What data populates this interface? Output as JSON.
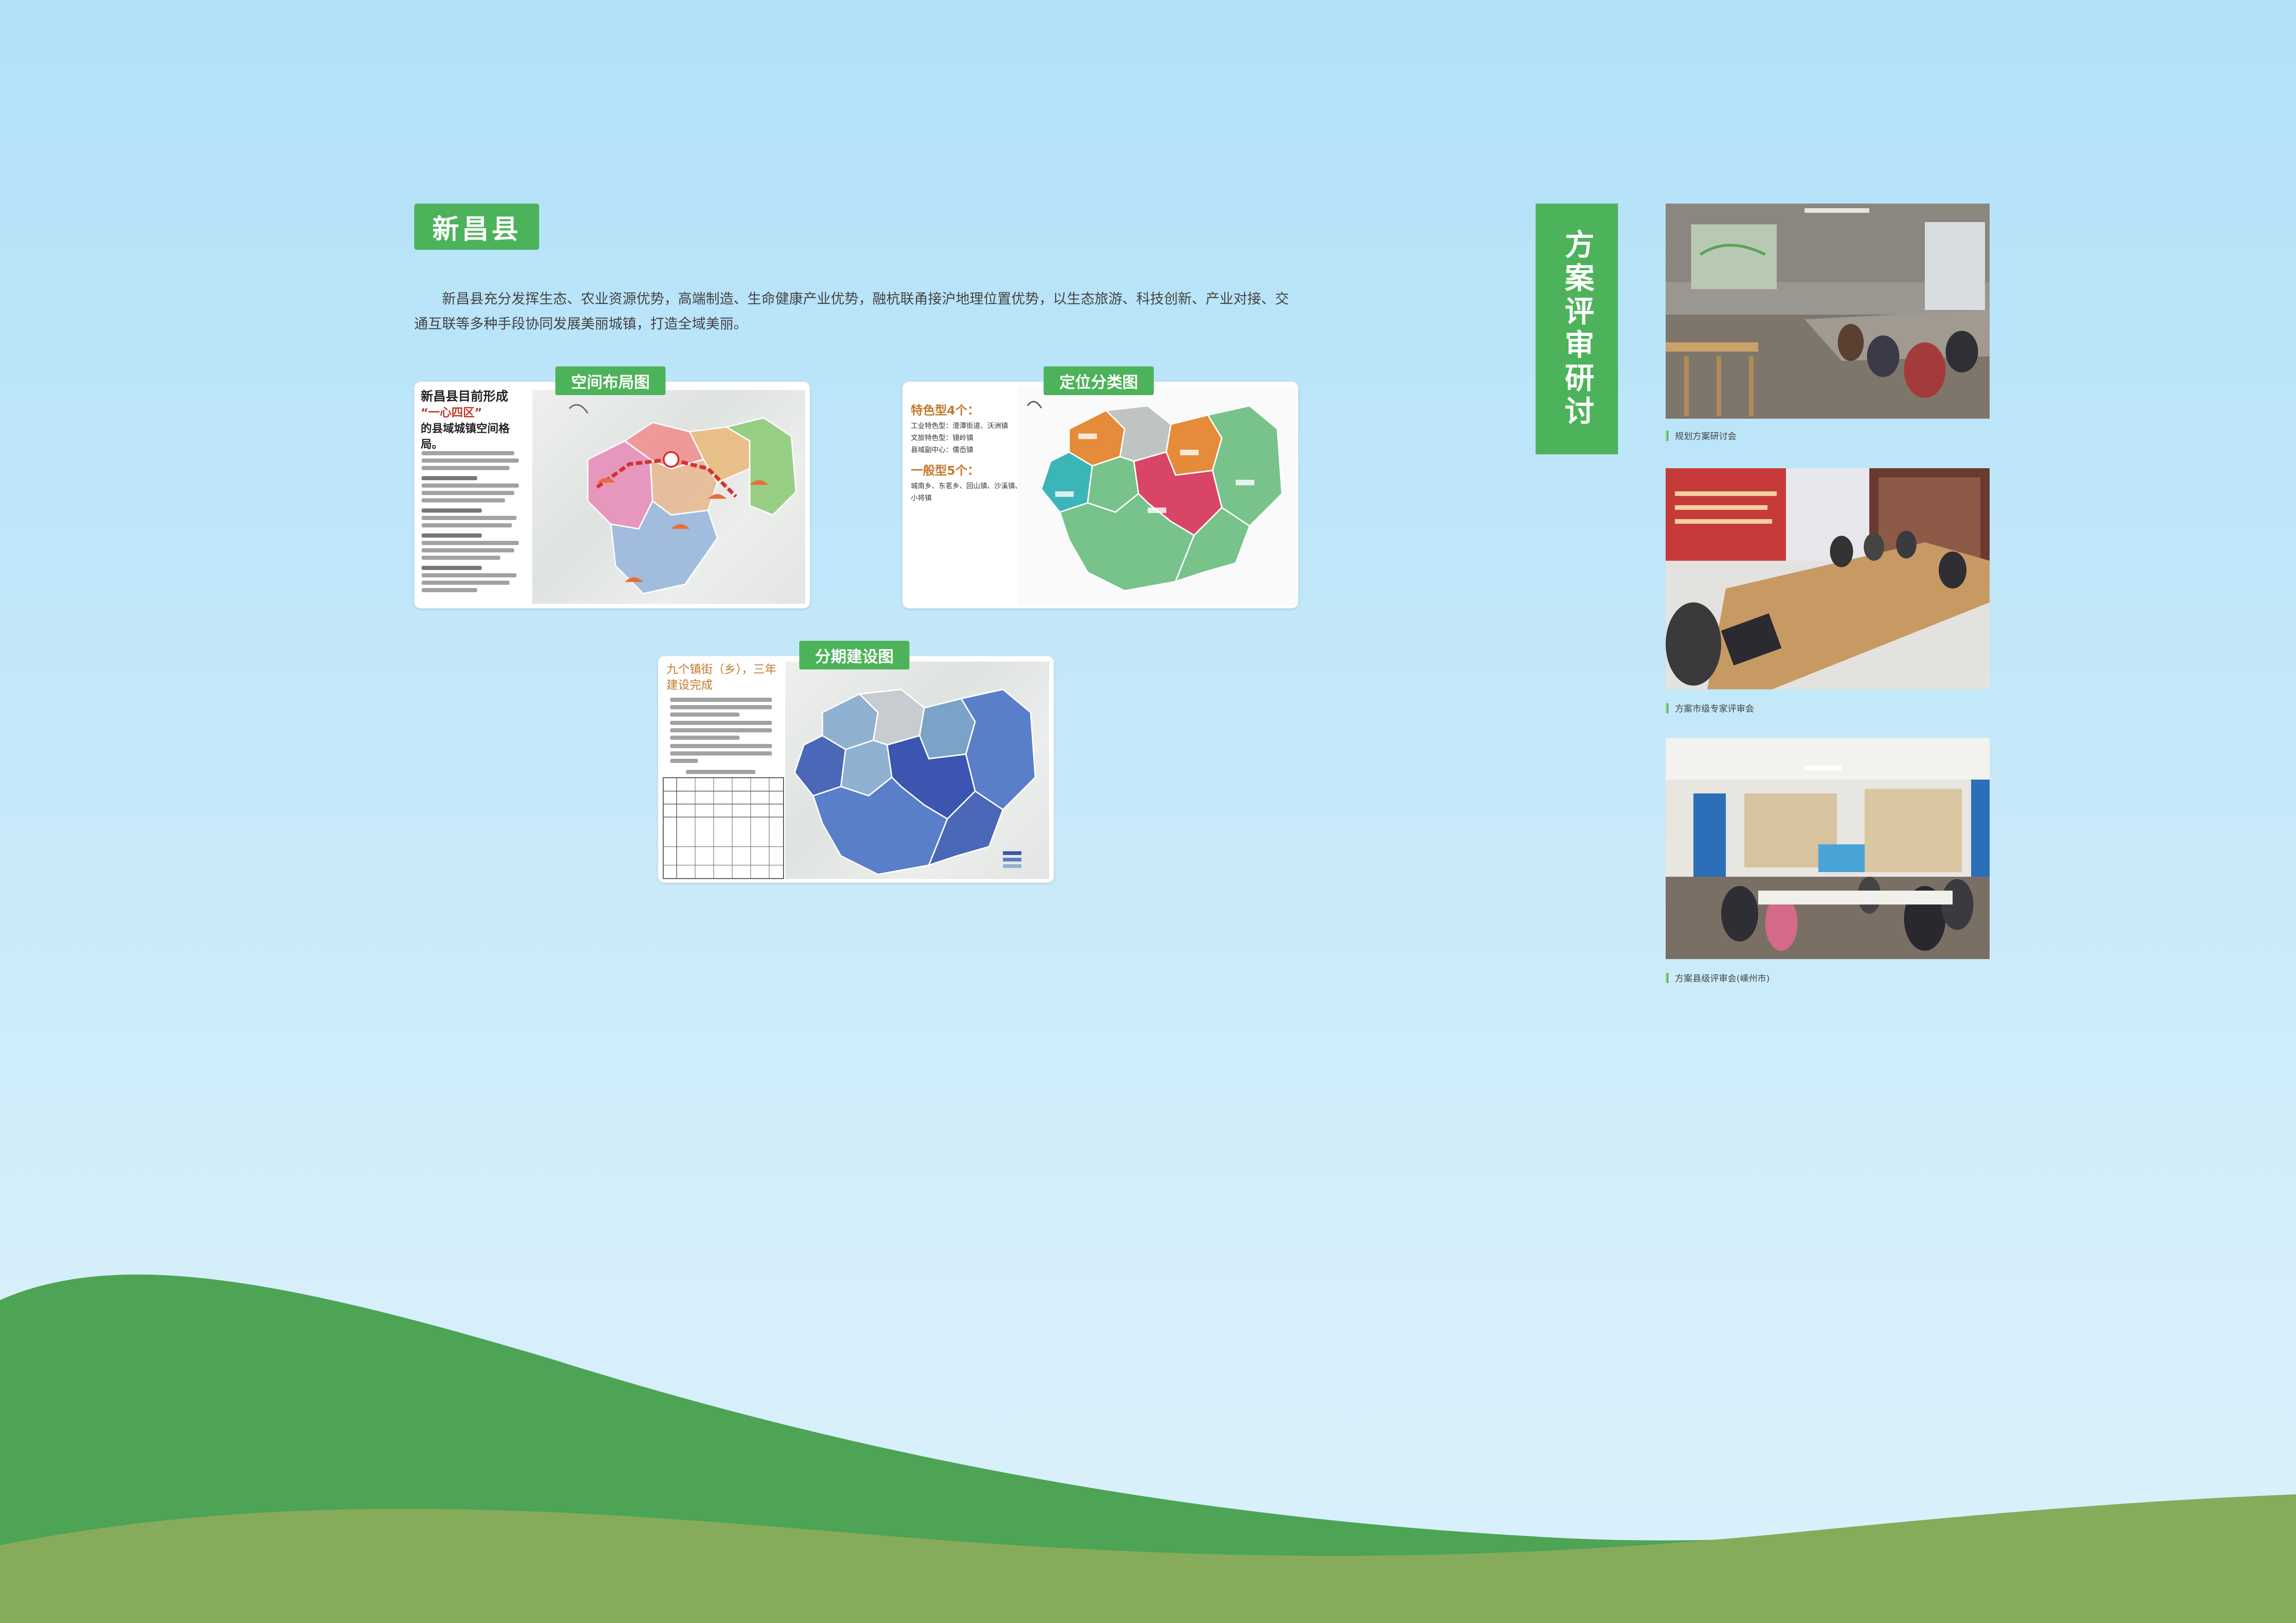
{
  "county": {
    "title": "新昌县"
  },
  "intro": "新昌县充分发挥生态、农业资源优势，高端制造、生命健康产业优势，融杭联甬接沪地理位置优势，以生态旅游、科技创新、产业对接、交通互联等多种手段协同发展美丽城镇，打造全域美丽。",
  "panels": {
    "spatial": {
      "label": "空间布局图",
      "heading_a": "新昌县目前形成",
      "heading_b": "“一心四区”",
      "heading_c": "的县域城镇空间格局。"
    },
    "positioning": {
      "label": "定位分类图",
      "special_title": "特色型4个：",
      "special_lines": [
        "工业特色型：澄潭街道、沃洲镇",
        "文旅特色型：镜岭镇",
        "县域副中心：儒岙镇"
      ],
      "general_title": "一般型5个：",
      "general_lines": [
        "城南乡、东茗乡、回山镇、沙溪镇、",
        "小将镇"
      ]
    },
    "phased": {
      "label": "分期建设图",
      "heading": "九个镇街（乡），三年建设完成"
    }
  },
  "review": {
    "banner": "方案评审研讨",
    "photos": [
      {
        "caption": "规划方案研讨会"
      },
      {
        "caption": "方案市级专家评审会"
      },
      {
        "caption": "方案县级评审会(嵊州市)"
      }
    ]
  },
  "colors": {
    "accent": "#4db35a",
    "hill_dark": "#4da455",
    "hill_light": "#86ab5b"
  }
}
